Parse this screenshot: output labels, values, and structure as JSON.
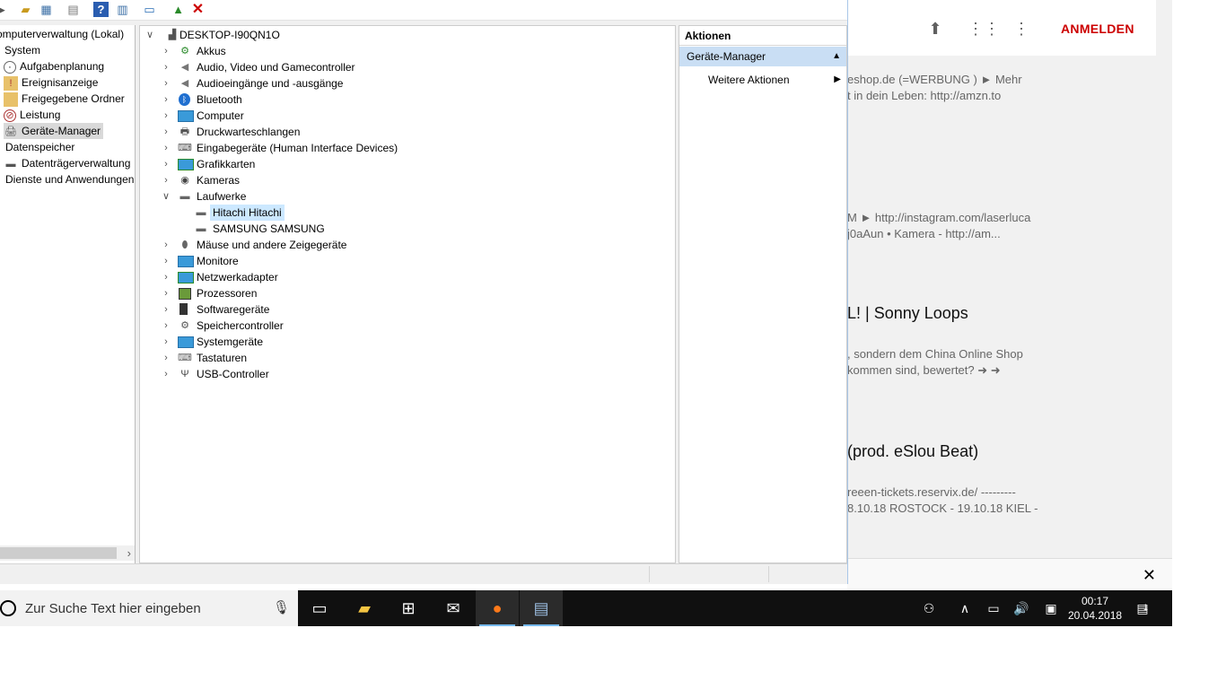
{
  "browser": {
    "signin_label": "ANMELDEN",
    "icons": [
      "upload-icon",
      "apps-grid-icon",
      "more-vert-icon"
    ],
    "results": [
      {
        "desc1": "eshop.de (=WERBUNG ) ► Mehr",
        "desc2": "t in dein Leben: http://amzn.to"
      },
      {
        "desc1": "M ► http://instagram.com/laserluca",
        "desc2": "j0aAun • Kamera - http://am..."
      },
      {
        "title": "L! | Sonny Loops",
        "desc1": ", sondern dem China Online Shop",
        "desc2": "kommen sind, bewertet? ➜ ➜"
      },
      {
        "title": "(prod. eSlou Beat)",
        "desc1": "reeen-tickets.reservix.de/ ---------",
        "desc2": "8.10.18 ROSTOCK - 19.10.18 KIEL -"
      }
    ],
    "notification_close": "✕"
  },
  "toolbar": {
    "icons": [
      "back-icon",
      "up-folder-icon",
      "show-hide-tree-icon",
      "properties-icon",
      "help-icon",
      "action-pane-icon",
      "monitor-icon",
      "update-driver-icon",
      "uninstall-icon"
    ]
  },
  "left_tree": {
    "items": [
      {
        "label": "omputerverwaltung (Lokal)",
        "indent": 0
      },
      {
        "label": "System",
        "indent": 0
      },
      {
        "label": "Aufgabenplanung",
        "indent": 1
      },
      {
        "label": "Ereignisanzeige",
        "indent": 1
      },
      {
        "label": "Freigegebene Ordner",
        "indent": 1
      },
      {
        "label": "Leistung",
        "indent": 1
      },
      {
        "label": "Geräte-Manager",
        "indent": 1,
        "selected": true
      },
      {
        "label": "Datenspeicher",
        "indent": 0
      },
      {
        "label": "Datenträgerverwaltung",
        "indent": 1
      },
      {
        "label": "Dienste und Anwendungen",
        "indent": 0
      }
    ]
  },
  "device_tree": {
    "root": "DESKTOP-I90QN1O",
    "categories": [
      {
        "label": "Akkus"
      },
      {
        "label": "Audio, Video und Gamecontroller"
      },
      {
        "label": "Audioeingänge und -ausgänge"
      },
      {
        "label": "Bluetooth"
      },
      {
        "label": "Computer"
      },
      {
        "label": "Druckwarteschlangen"
      },
      {
        "label": "Eingabegeräte (Human Interface Devices)"
      },
      {
        "label": "Grafikkarten"
      },
      {
        "label": "Kameras"
      },
      {
        "label": "Laufwerke",
        "expanded": true
      },
      {
        "label": "Hitachi Hitachi",
        "child": true,
        "selected": true
      },
      {
        "label": "SAMSUNG SAMSUNG",
        "child": true
      },
      {
        "label": "Mäuse und andere Zeigegeräte"
      },
      {
        "label": "Monitore"
      },
      {
        "label": "Netzwerkadapter"
      },
      {
        "label": "Prozessoren"
      },
      {
        "label": "Softwaregeräte"
      },
      {
        "label": "Speichercontroller"
      },
      {
        "label": "Systemgeräte"
      },
      {
        "label": "Tastaturen"
      },
      {
        "label": "USB-Controller"
      }
    ]
  },
  "actions": {
    "header": "Aktionen",
    "section": "Geräte-Manager",
    "more": "Weitere Aktionen"
  },
  "taskbar": {
    "search_placeholder": "Zur Suche Text hier eingeben",
    "apps": [
      "task-view-icon",
      "file-explorer-icon",
      "store-icon",
      "mail-icon",
      "firefox-icon",
      "computer-management-icon"
    ],
    "time": "00:17",
    "date": "20.04.2018",
    "notification_count": "1"
  }
}
